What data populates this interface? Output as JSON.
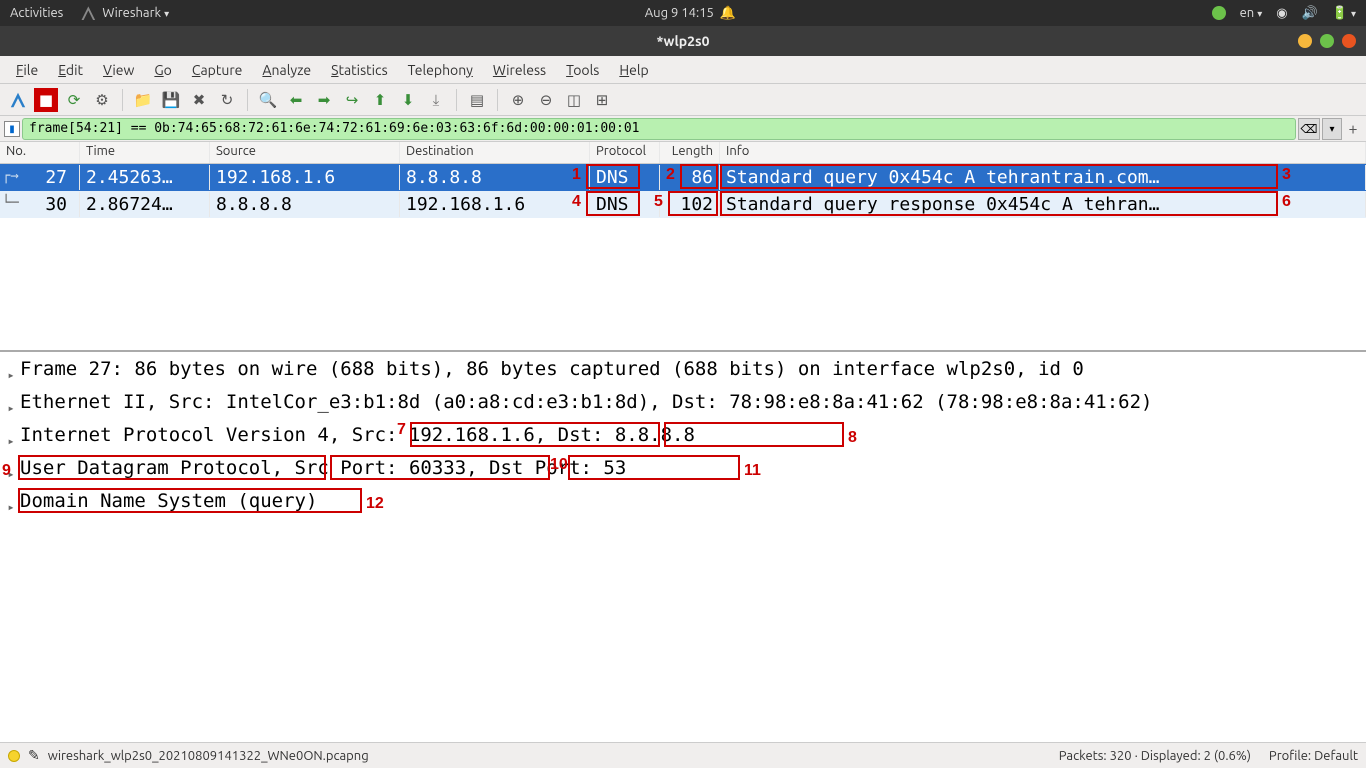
{
  "gnome": {
    "activities": "Activities",
    "app": "Wireshark",
    "datetime": "Aug 9  14:15",
    "lang": "en"
  },
  "window": {
    "title": "*wlp2s0"
  },
  "menu": {
    "file": "File",
    "edit": "Edit",
    "view": "View",
    "go": "Go",
    "capture": "Capture",
    "analyze": "Analyze",
    "statistics": "Statistics",
    "telephony": "Telephony",
    "wireless": "Wireless",
    "tools": "Tools",
    "help": "Help"
  },
  "filter": {
    "value": "frame[54:21] == 0b:74:65:68:72:61:6e:74:72:61:69:6e:03:63:6f:6d:00:00:01:00:01"
  },
  "columns": {
    "no": "No.",
    "time": "Time",
    "source": "Source",
    "destination": "Destination",
    "protocol": "Protocol",
    "length": "Length",
    "info": "Info"
  },
  "rows": [
    {
      "no": "27",
      "time": "2.45263…",
      "src": "192.168.1.6",
      "dst": "8.8.8.8",
      "proto": "DNS",
      "len": "86",
      "info": "Standard query 0x454c A tehrantrain.com…",
      "selected": true
    },
    {
      "no": "30",
      "time": "2.86724…",
      "src": "8.8.8.8",
      "dst": "192.168.1.6",
      "proto": "DNS",
      "len": "102",
      "info": "Standard query response 0x454c A tehran…",
      "selected": false
    }
  ],
  "details": {
    "l0": "Frame 27: 86 bytes on wire (688 bits), 86 bytes captured (688 bits) on interface wlp2s0, id 0",
    "l1": "Ethernet II, Src: IntelCor_e3:b1:8d (a0:a8:cd:e3:b1:8d), Dst: 78:98:e8:8a:41:62 (78:98:e8:8a:41:62)",
    "l2a": "Internet Protocol Version 4,",
    "l2b": " Src: 192.168.1.6,",
    "l2c": " Dst: 8.8.8.8",
    "l3a": "User Datagram Protocol,",
    "l3b": " Src Port: 60333,",
    "l3c": " Dst Port: 53",
    "l4": "Domain Name System (query)"
  },
  "annotations": {
    "n1": "1",
    "n2": "2",
    "n3": "3",
    "n4": "4",
    "n5": "5",
    "n6": "6",
    "n7": "7",
    "n8": "8",
    "n9": "9",
    "n10": "10",
    "n11": "11",
    "n12": "12"
  },
  "status": {
    "file": "wireshark_wlp2s0_20210809141322_WNe0ON.pcapng",
    "packets": "Packets: 320 · Displayed: 2 (0.6%)",
    "profile": "Profile: Default"
  }
}
